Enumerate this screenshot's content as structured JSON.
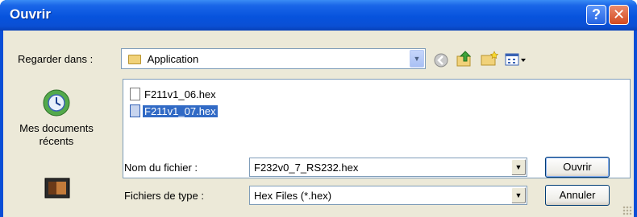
{
  "window": {
    "title": "Ouvrir"
  },
  "lookin": {
    "label": "Regarder dans :",
    "value": "Application"
  },
  "files": [
    {
      "name": "F211v1_06.hex",
      "selected": false
    },
    {
      "name": "F211v1_07.hex",
      "selected": true
    }
  ],
  "places": {
    "recent_label": "Mes documents récents"
  },
  "filename": {
    "label": "Nom du fichier :",
    "value": "F232v0_7_RS232.hex"
  },
  "filetype": {
    "label": "Fichiers de type :",
    "value": "Hex Files (*.hex)"
  },
  "buttons": {
    "open": "Ouvrir",
    "cancel": "Annuler"
  }
}
